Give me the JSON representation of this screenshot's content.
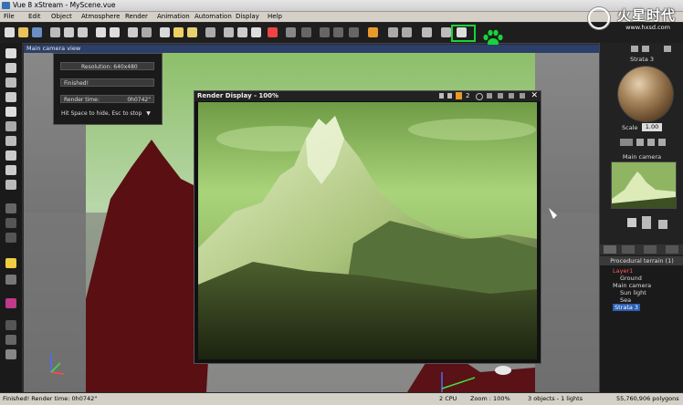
{
  "window": {
    "title": "Vue 8 xStream - MyScene.vue"
  },
  "watermark": {
    "text": "火星时代",
    "url": "www.hxsd.com"
  },
  "menu": [
    "File",
    "Edit",
    "Object",
    "Atmosphere",
    "Render",
    "Animation",
    "Automation",
    "Display",
    "Help"
  ],
  "viewport": {
    "title": "Main camera view"
  },
  "render_info": {
    "resolution": "Resolution: 640x480",
    "status": "Finished!",
    "render_time_label": "Render time:",
    "render_time_value": "0h0742\"",
    "hint": "Hit Space to hide, Esc to stop"
  },
  "render_window": {
    "title": "Render Display - 100%",
    "page": "2",
    "close": "✕"
  },
  "right_panel": {
    "material_title": "Strata 3",
    "scale_label": "Scale",
    "scale_value": "1.00",
    "camera_title": "Main camera",
    "tree_header": "Procedural terrain (1)",
    "tree_items": [
      "Layer1",
      "Ground",
      "Main camera",
      "Sun light",
      "Sea",
      "Strata 3"
    ]
  },
  "status": {
    "left": "Finished! Render time: 0h0742\"",
    "cpu": "2 CPU",
    "zoom": "Zoom : 100%",
    "objects": "3 objects - 1 lights",
    "polygons": "55,760,906 polygons"
  },
  "colors": {
    "highlight": "#19d33a",
    "accent": "#2c3f6a",
    "selection": "#2b5fb3"
  }
}
